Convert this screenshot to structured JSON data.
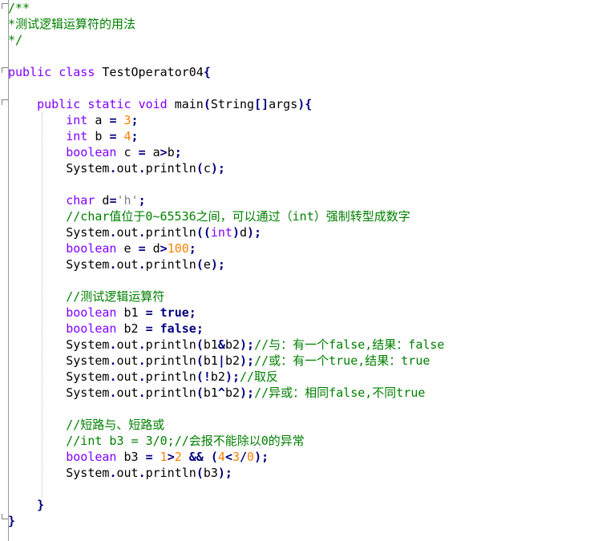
{
  "editor": {
    "colors": {
      "keyword": "#8000ff",
      "literal_keyword": "#000080",
      "number": "#ff8000",
      "operator": "#000080",
      "comment": "#008000",
      "char_literal": "#808080",
      "text": "#000000",
      "background": "#ffffff"
    },
    "lines": [
      [
        [
          "cm",
          "/**"
        ]
      ],
      [
        [
          "cm",
          "*测试逻辑运算符的用法"
        ]
      ],
      [
        [
          "cm",
          "*/"
        ]
      ],
      [],
      [
        [
          "kw",
          "public"
        ],
        [
          "tx",
          " "
        ],
        [
          "kw",
          "class"
        ],
        [
          "tx",
          " TestOperator04"
        ],
        [
          "op",
          "{"
        ]
      ],
      [],
      [
        [
          "tx",
          "    "
        ],
        [
          "kw",
          "public"
        ],
        [
          "tx",
          " "
        ],
        [
          "kw",
          "static"
        ],
        [
          "tx",
          " "
        ],
        [
          "kw",
          "void"
        ],
        [
          "tx",
          " main"
        ],
        [
          "op",
          "("
        ],
        [
          "tx",
          "String"
        ],
        [
          "op",
          "[]"
        ],
        [
          "tx",
          "args"
        ],
        [
          "op",
          "){"
        ]
      ],
      [
        [
          "tx",
          "        "
        ],
        [
          "kw",
          "int"
        ],
        [
          "tx",
          " a "
        ],
        [
          "op",
          "="
        ],
        [
          "tx",
          " "
        ],
        [
          "num",
          "3"
        ],
        [
          "op",
          ";"
        ]
      ],
      [
        [
          "tx",
          "        "
        ],
        [
          "kw",
          "int"
        ],
        [
          "tx",
          " b "
        ],
        [
          "op",
          "="
        ],
        [
          "tx",
          " "
        ],
        [
          "num",
          "4"
        ],
        [
          "op",
          ";"
        ]
      ],
      [
        [
          "tx",
          "        "
        ],
        [
          "kw",
          "boolean"
        ],
        [
          "tx",
          " c "
        ],
        [
          "op",
          "="
        ],
        [
          "tx",
          " a"
        ],
        [
          "op",
          ">"
        ],
        [
          "tx",
          "b"
        ],
        [
          "op",
          ";"
        ]
      ],
      [
        [
          "tx",
          "        System"
        ],
        [
          "op",
          "."
        ],
        [
          "tx",
          "out"
        ],
        [
          "op",
          "."
        ],
        [
          "tx",
          "println"
        ],
        [
          "op",
          "("
        ],
        [
          "tx",
          "c"
        ],
        [
          "op",
          ");"
        ]
      ],
      [],
      [
        [
          "tx",
          "        "
        ],
        [
          "kw",
          "char"
        ],
        [
          "tx",
          " d"
        ],
        [
          "op",
          "="
        ],
        [
          "ch",
          "'h'"
        ],
        [
          "op",
          ";"
        ]
      ],
      [
        [
          "tx",
          "        "
        ],
        [
          "cm",
          "//char值位于0~65536之间，可以通过（int）强制转型成数字"
        ]
      ],
      [
        [
          "tx",
          "        System"
        ],
        [
          "op",
          "."
        ],
        [
          "tx",
          "out"
        ],
        [
          "op",
          "."
        ],
        [
          "tx",
          "println"
        ],
        [
          "op",
          "(("
        ],
        [
          "kw",
          "int"
        ],
        [
          "op",
          ")"
        ],
        [
          "tx",
          "d"
        ],
        [
          "op",
          ");"
        ]
      ],
      [
        [
          "tx",
          "        "
        ],
        [
          "kw",
          "boolean"
        ],
        [
          "tx",
          " e "
        ],
        [
          "op",
          "="
        ],
        [
          "tx",
          " d"
        ],
        [
          "op",
          ">"
        ],
        [
          "num",
          "100"
        ],
        [
          "op",
          ";"
        ]
      ],
      [
        [
          "tx",
          "        System"
        ],
        [
          "op",
          "."
        ],
        [
          "tx",
          "out"
        ],
        [
          "op",
          "."
        ],
        [
          "tx",
          "println"
        ],
        [
          "op",
          "("
        ],
        [
          "tx",
          "e"
        ],
        [
          "op",
          ");"
        ]
      ],
      [],
      [
        [
          "tx",
          "        "
        ],
        [
          "cm",
          "//测试逻辑运算符"
        ]
      ],
      [
        [
          "tx",
          "        "
        ],
        [
          "kw",
          "boolean"
        ],
        [
          "tx",
          " b1 "
        ],
        [
          "op",
          "="
        ],
        [
          "tx",
          " "
        ],
        [
          "kwb",
          "true"
        ],
        [
          "op",
          ";"
        ]
      ],
      [
        [
          "tx",
          "        "
        ],
        [
          "kw",
          "boolean"
        ],
        [
          "tx",
          " b2 "
        ],
        [
          "op",
          "="
        ],
        [
          "tx",
          " "
        ],
        [
          "kwb",
          "false"
        ],
        [
          "op",
          ";"
        ]
      ],
      [
        [
          "tx",
          "        System"
        ],
        [
          "op",
          "."
        ],
        [
          "tx",
          "out"
        ],
        [
          "op",
          "."
        ],
        [
          "tx",
          "println"
        ],
        [
          "op",
          "("
        ],
        [
          "tx",
          "b1"
        ],
        [
          "op",
          "&"
        ],
        [
          "tx",
          "b2"
        ],
        [
          "op",
          ");"
        ],
        [
          "cm",
          "//与：有一个false,结果：false"
        ]
      ],
      [
        [
          "tx",
          "        System"
        ],
        [
          "op",
          "."
        ],
        [
          "tx",
          "out"
        ],
        [
          "op",
          "."
        ],
        [
          "tx",
          "println"
        ],
        [
          "op",
          "("
        ],
        [
          "tx",
          "b1"
        ],
        [
          "op",
          "|"
        ],
        [
          "tx",
          "b2"
        ],
        [
          "op",
          ");"
        ],
        [
          "cm",
          "//或：有一个true,结果：true"
        ]
      ],
      [
        [
          "tx",
          "        System"
        ],
        [
          "op",
          "."
        ],
        [
          "tx",
          "out"
        ],
        [
          "op",
          "."
        ],
        [
          "tx",
          "println"
        ],
        [
          "op",
          "(!"
        ],
        [
          "tx",
          "b2"
        ],
        [
          "op",
          ");"
        ],
        [
          "cm",
          "//取反"
        ]
      ],
      [
        [
          "tx",
          "        System"
        ],
        [
          "op",
          "."
        ],
        [
          "tx",
          "out"
        ],
        [
          "op",
          "."
        ],
        [
          "tx",
          "println"
        ],
        [
          "op",
          "("
        ],
        [
          "tx",
          "b1"
        ],
        [
          "op",
          "^"
        ],
        [
          "tx",
          "b2"
        ],
        [
          "op",
          ");"
        ],
        [
          "cm",
          "//异或：相同false,不同true"
        ]
      ],
      [],
      [
        [
          "tx",
          "        "
        ],
        [
          "cm",
          "//短路与、短路或"
        ]
      ],
      [
        [
          "tx",
          "        "
        ],
        [
          "cm",
          "//int b3 = 3/0;//会报不能除以0的异常"
        ]
      ],
      [
        [
          "tx",
          "        "
        ],
        [
          "kw",
          "boolean"
        ],
        [
          "tx",
          " b3 "
        ],
        [
          "op",
          "="
        ],
        [
          "tx",
          " "
        ],
        [
          "num",
          "1"
        ],
        [
          "op",
          ">"
        ],
        [
          "num",
          "2"
        ],
        [
          "tx",
          " "
        ],
        [
          "op",
          "&&"
        ],
        [
          "tx",
          " "
        ],
        [
          "op",
          "("
        ],
        [
          "num",
          "4"
        ],
        [
          "op",
          "<"
        ],
        [
          "num",
          "3"
        ],
        [
          "op",
          "/"
        ],
        [
          "num",
          "0"
        ],
        [
          "op",
          ");"
        ]
      ],
      [
        [
          "tx",
          "        System"
        ],
        [
          "op",
          "."
        ],
        [
          "tx",
          "out"
        ],
        [
          "op",
          "."
        ],
        [
          "tx",
          "println"
        ],
        [
          "op",
          "("
        ],
        [
          "tx",
          "b3"
        ],
        [
          "op",
          ");"
        ]
      ],
      [],
      [
        [
          "tx",
          "    "
        ],
        [
          "op",
          "}"
        ]
      ],
      [
        [
          "op",
          "}"
        ]
      ]
    ]
  }
}
